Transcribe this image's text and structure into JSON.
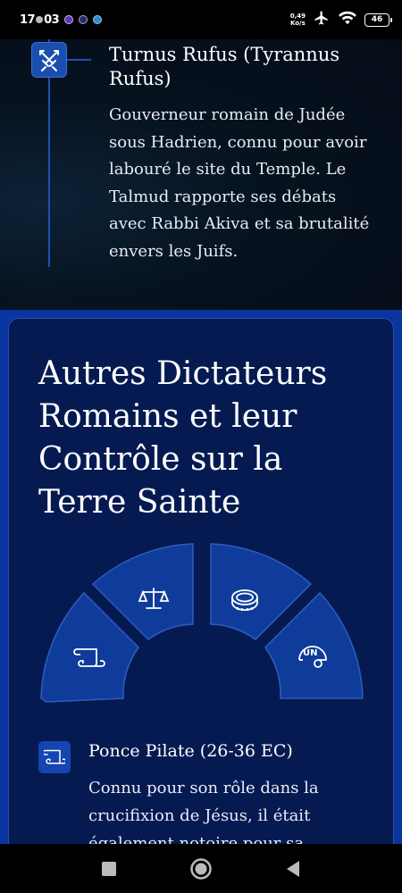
{
  "status_bar": {
    "time": "17",
    "time_suffix": "03",
    "speed_value": "0,49",
    "speed_unit": "Ko/s",
    "battery": "46"
  },
  "timeline_entry": {
    "title": "Turnus Rufus (Tyrannus Rufus)",
    "description": "Gouverneur romain de Judée sous Hadrien, connu pour avoir labouré le site du Temple. Le Talmud rapporte ses débats avec Rabbi Akiva et sa brutalité envers les Juifs.",
    "icon": "crossed-swords-icon"
  },
  "section": {
    "title": "Autres Dictateurs Romains et leur Contrôle sur la Terre Sainte",
    "fan_icons": [
      "scroll-icon",
      "scales-icon",
      "coin-icon",
      "un-helmet-icon"
    ],
    "item": {
      "icon": "scroll-icon",
      "title": "Ponce Pilate (26-36 EC)",
      "description": "Connu pour son rôle dans la crucifixion de Jésus, il était également notoire pour sa"
    }
  },
  "colors": {
    "accent": "#1a4fb0",
    "section_bg": "#0a34a0",
    "card_bg": "#061a52"
  }
}
